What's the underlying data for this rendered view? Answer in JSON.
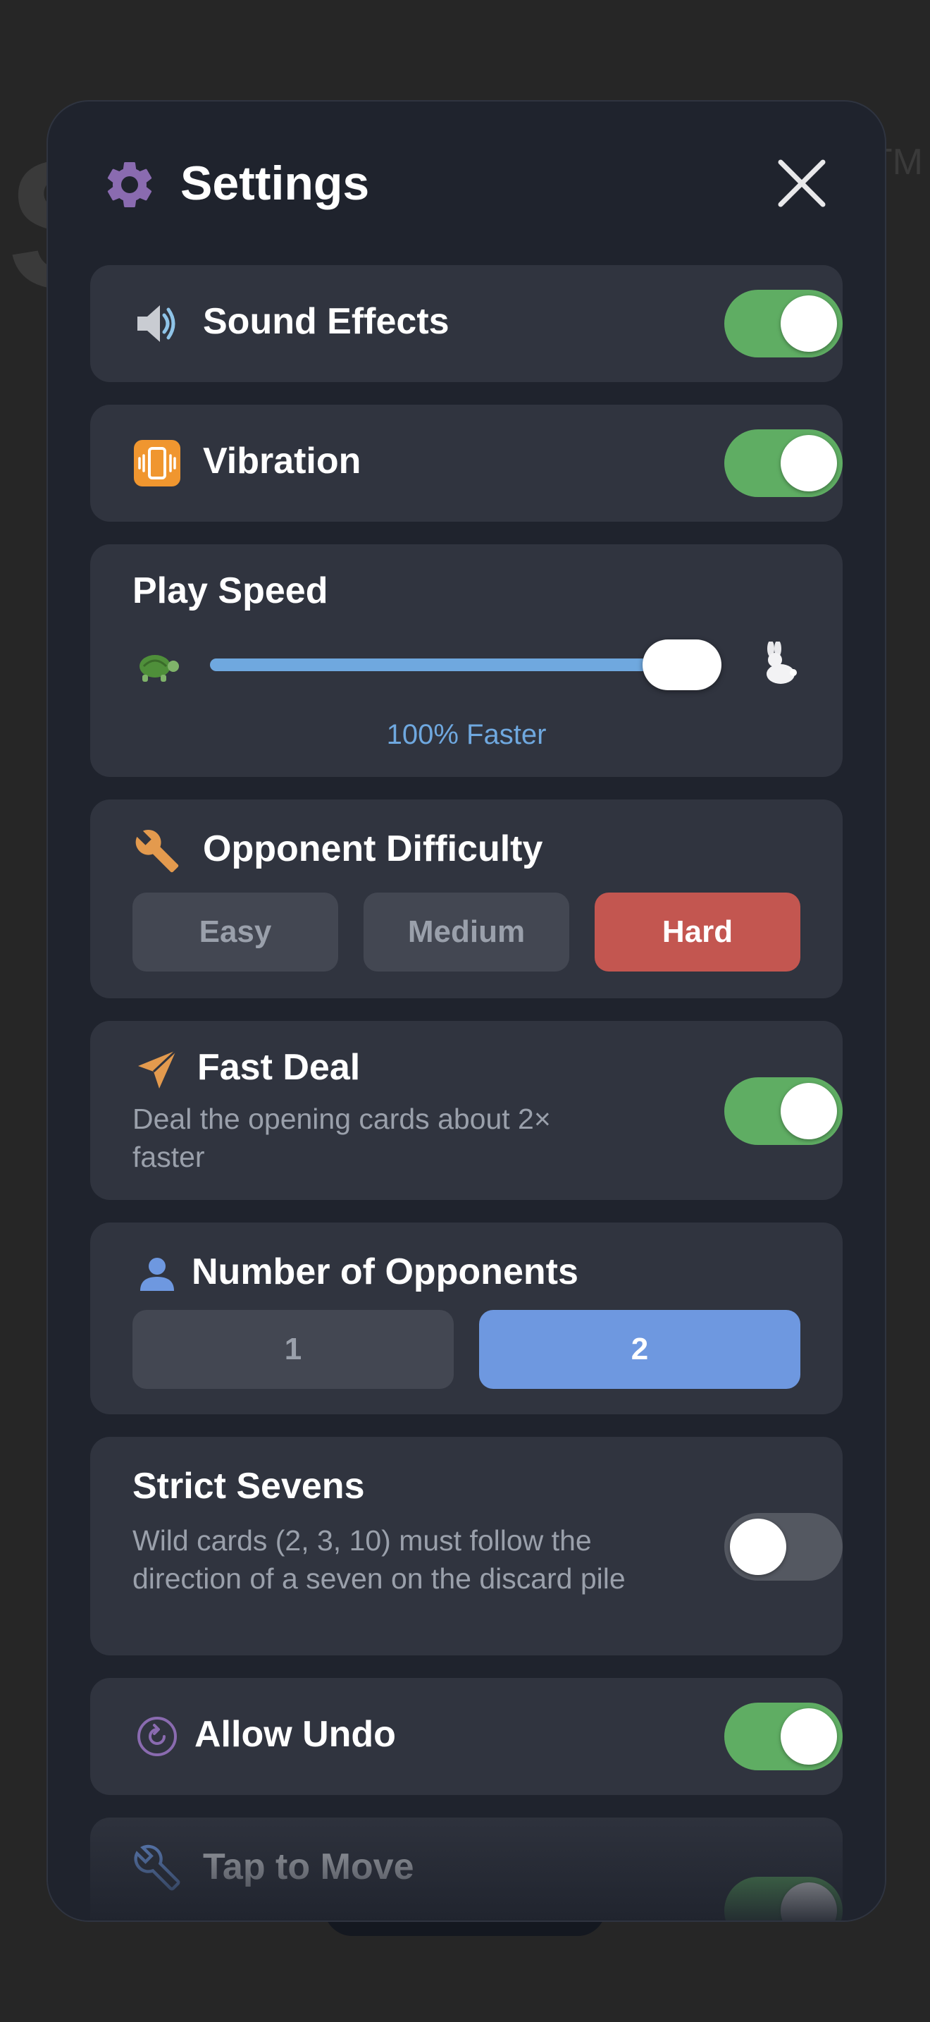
{
  "background": {
    "letter": "S",
    "trademark": "TM"
  },
  "header": {
    "title": "Settings",
    "icon": "gear-icon",
    "close_icon": "close-icon"
  },
  "colors": {
    "toggle_on": "#5fad63",
    "toggle_off": "#545861",
    "accent_blue": "#6e98e0",
    "slider_blue": "#6fa8df",
    "hard_red": "#c35650",
    "card_bg": "#30343f",
    "modal_bg": "#1f232d"
  },
  "settings": {
    "sound_effects": {
      "label": "Sound Effects",
      "icon": "speaker-icon",
      "enabled": true
    },
    "vibration": {
      "label": "Vibration",
      "icon": "vibration-icon",
      "enabled": true
    },
    "play_speed": {
      "label": "Play Speed",
      "slow_icon": "turtle-icon",
      "fast_icon": "rabbit-icon",
      "value_text": "100% Faster",
      "level": 1.0
    },
    "opponent_difficulty": {
      "label": "Opponent Difficulty",
      "icon": "wrench-icon",
      "options": [
        "Easy",
        "Medium",
        "Hard"
      ],
      "selected": "Hard"
    },
    "fast_deal": {
      "label": "Fast Deal",
      "icon": "paper-plane-icon",
      "description": "Deal the opening cards about 2× faster",
      "enabled": true
    },
    "number_of_opponents": {
      "label": "Number of Opponents",
      "icon": "person-icon",
      "options": [
        "1",
        "2"
      ],
      "selected": "2"
    },
    "strict_sevens": {
      "label": "Strict Sevens",
      "description": "Wild cards (2, 3, 10) must follow the direction of a seven on the discard pile",
      "enabled": false
    },
    "allow_undo": {
      "label": "Allow Undo",
      "icon": "undo-icon",
      "enabled": true
    },
    "tap_to_move": {
      "label": "Tap to Move",
      "icon": "wrench-icon",
      "enabled": true
    }
  }
}
